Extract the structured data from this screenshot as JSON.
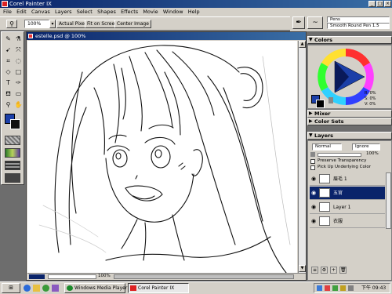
{
  "app": {
    "title": "Corel Painter IX"
  },
  "menu": [
    "File",
    "Edit",
    "Canvas",
    "Layers",
    "Select",
    "Shapes",
    "Effects",
    "Movie",
    "Window",
    "Help"
  ],
  "propbar": {
    "zoom_value": "100%",
    "actual_pixels": "Actual Pixels",
    "fit_on_screen": "Fit on Screen",
    "center_image": "Center Image"
  },
  "brush": {
    "category": "Pens",
    "variant": "Smooth Round Pen 1.5"
  },
  "document": {
    "title": "estelle.psd @ 100%",
    "status_zoom": "100%"
  },
  "colors_panel": {
    "title": "Colors",
    "readout": [
      "R: 0%",
      "S: 0%",
      "V: 0%"
    ],
    "accent": "#1b3fa8"
  },
  "mixer_panel": {
    "title": "Mixer"
  },
  "colorsets_panel": {
    "title": "Color Sets"
  },
  "layers_panel": {
    "title": "Layers",
    "composite_method": "Normal",
    "composite_depth": "Ignore",
    "opacity": "100%",
    "preserve_transparency": "Preserve Transparency",
    "pick_up_underlying": "Pick Up Underlying Color",
    "layers": [
      {
        "name": "眉毛 1",
        "selected": false
      },
      {
        "name": "五官",
        "selected": true
      },
      {
        "name": "Layer 1",
        "selected": false
      },
      {
        "name": "衣服",
        "selected": false
      }
    ]
  },
  "taskbar": {
    "tasks": [
      "Windows Media Player",
      "Corel Painter IX"
    ],
    "clock": "下午 09:43"
  }
}
